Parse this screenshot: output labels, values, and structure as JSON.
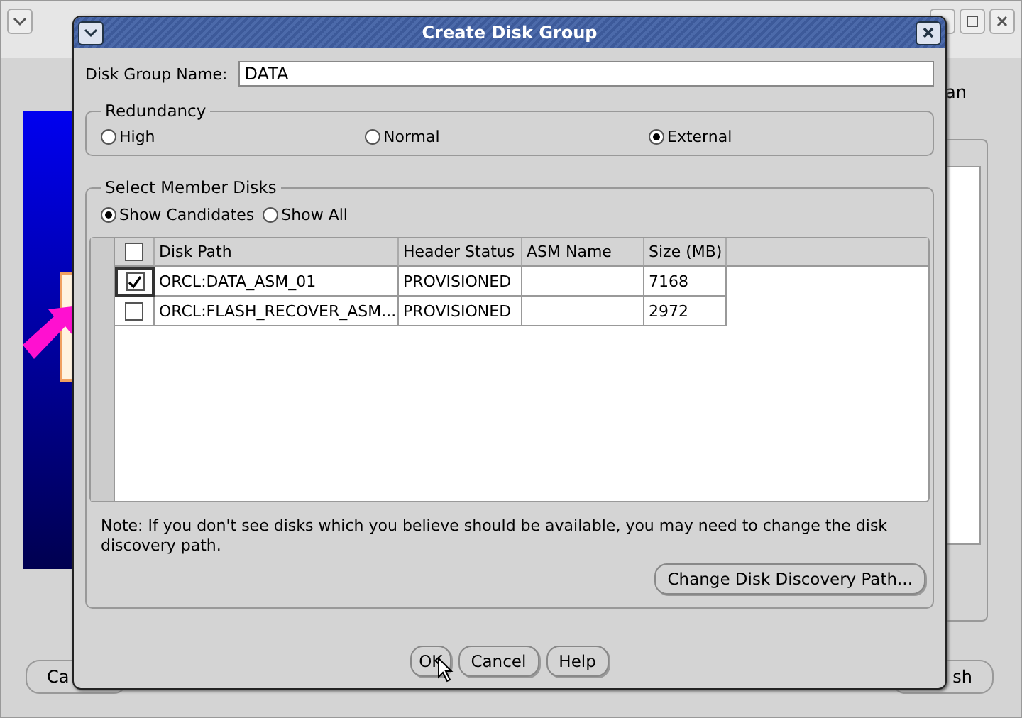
{
  "background_window": {
    "label_fragment": "an",
    "buttons": [
      "Ca",
      "sh"
    ]
  },
  "dialog": {
    "title": "Create Disk Group"
  },
  "disk_group_name": {
    "label": "Disk Group Name:",
    "value": "DATA"
  },
  "redundancy": {
    "title": "Redundancy",
    "options": [
      {
        "label": "High",
        "selected": false
      },
      {
        "label": "Normal",
        "selected": false
      },
      {
        "label": "External",
        "selected": true
      }
    ]
  },
  "member_disks": {
    "title": "Select Member Disks",
    "filters": [
      {
        "label": "Show Candidates",
        "selected": true
      },
      {
        "label": "Show All",
        "selected": false
      }
    ],
    "table": {
      "select_all_checked": false,
      "columns": [
        "Disk Path",
        "Header Status",
        "ASM Name",
        "Size (MB)"
      ],
      "rows": [
        {
          "checked": true,
          "disk_path": "ORCL:DATA_ASM_01",
          "header_status": "PROVISIONED",
          "size": "7168"
        },
        {
          "checked": false,
          "disk_path": "ORCL:FLASH_RECOVER_ASM...",
          "header_status": "PROVISIONED",
          "size": "2972"
        }
      ]
    },
    "note": "Note: If you don't see disks which you believe should be available, you may need to change the disk discovery path.",
    "discovery_button": "Change Disk Discovery Path..."
  },
  "buttons": [
    "OK",
    "Cancel",
    "Help"
  ]
}
